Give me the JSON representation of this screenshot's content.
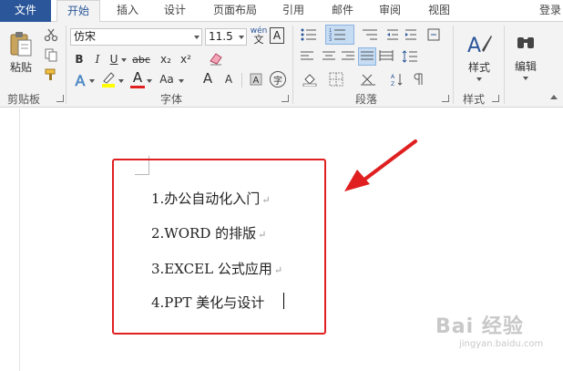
{
  "tabs": [
    {
      "label": "文件",
      "name": "tab-file"
    },
    {
      "label": "开始",
      "name": "tab-home"
    },
    {
      "label": "插入",
      "name": "tab-insert"
    },
    {
      "label": "设计",
      "name": "tab-design"
    },
    {
      "label": "页面布局",
      "name": "tab-page-layout"
    },
    {
      "label": "引用",
      "name": "tab-references"
    },
    {
      "label": "邮件",
      "name": "tab-mailings"
    },
    {
      "label": "审阅",
      "name": "tab-review"
    },
    {
      "label": "视图",
      "name": "tab-view"
    }
  ],
  "login": "登录",
  "ribbon": {
    "clipboard": {
      "label": "剪贴板",
      "paste": "粘贴"
    },
    "font": {
      "label": "字体",
      "font_name": "仿宋",
      "font_size": "11.5",
      "wen": "wén",
      "wen_char": "文",
      "A_box": "A",
      "bold": "B",
      "italic": "I",
      "underline": "U",
      "strike": "abc",
      "sub": "x₂",
      "sup": "x²",
      "text_effect": "A",
      "font_color": "A",
      "case": "Aa",
      "grow": "A",
      "shrink": "A",
      "enclose": "字"
    },
    "paragraph": {
      "label": "段落"
    },
    "styles": {
      "label": "样式",
      "btn": "样式"
    },
    "editing": {
      "btn": "编辑"
    }
  },
  "document": {
    "items": [
      "1.办公自动化入门",
      "2.WORD 的排版",
      "3.EXCEL 公式应用",
      "4.PPT 美化与设计"
    ]
  },
  "watermark": {
    "text": "Bai 经验",
    "sub": "jingyan.baidu.com"
  },
  "colors": {
    "accent": "#2b579a",
    "highlight": "#e02020",
    "arrow": "#e02020"
  }
}
